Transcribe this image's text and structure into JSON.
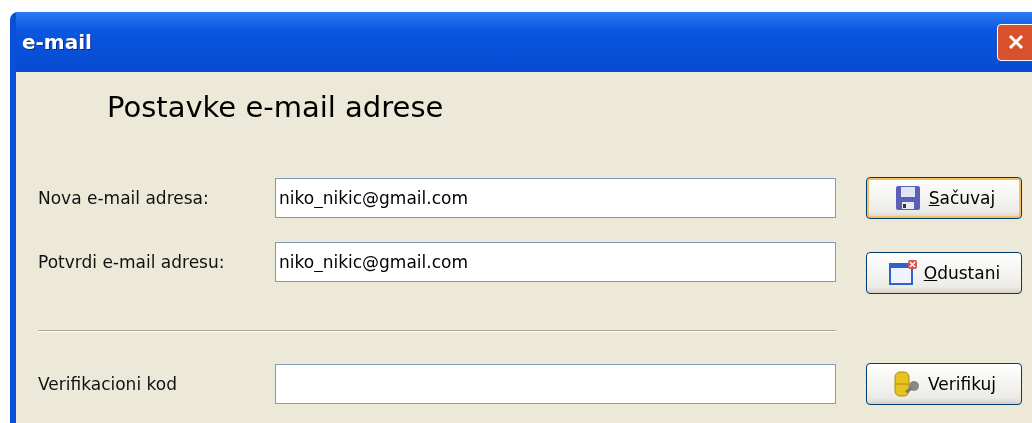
{
  "window": {
    "title": "e-mail"
  },
  "heading": "Postavke e-mail adrese",
  "fields": [
    {
      "label": "Nova e-mail adresa:",
      "value": "niko_nikic@gmail.com"
    },
    {
      "label": "Potvrdi e-mail adresu:",
      "value": "niko_nikic@gmail.com"
    },
    {
      "label": "Verifikacioni kod"
    }
  ],
  "buttons": [
    {
      "label": "Sačuvaj",
      "kind": "save",
      "mnemonic": true,
      "default": true
    },
    {
      "label": "Odustani",
      "kind": "cancel",
      "mnemonic": true,
      "default": false
    },
    {
      "label": "Verifikuj",
      "kind": "verify",
      "mnemonic": false,
      "default": false
    }
  ]
}
